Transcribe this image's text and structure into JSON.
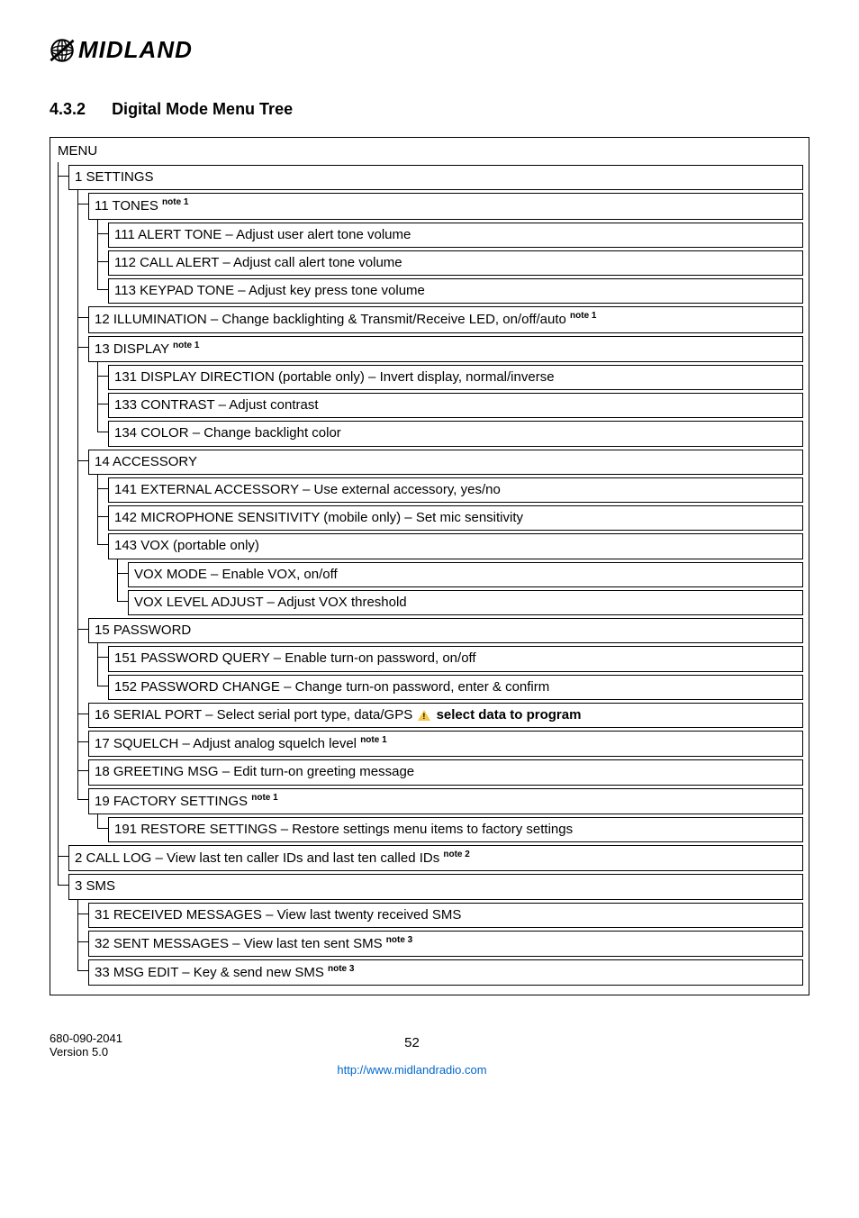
{
  "logo": {
    "brand": "MIDLAND"
  },
  "section": {
    "number": "4.3.2",
    "title": "Digital Mode Menu Tree"
  },
  "menu": {
    "root": "MENU",
    "n1": "1 SETTINGS",
    "n11": "11 TONES ",
    "n11_note": "note 1",
    "n111": "111 ALERT TONE – Adjust user alert tone volume",
    "n112": "112 CALL ALERT – Adjust call alert tone volume",
    "n113": "113 KEYPAD TONE – Adjust key press tone volume",
    "n12": "12 ILLUMINATION – Change backlighting & Transmit/Receive LED, on/off/auto ",
    "n12_note": "note 1",
    "n13": "13 DISPLAY ",
    "n13_note": "note 1",
    "n131": "131 DISPLAY DIRECTION (portable only) – Invert display, normal/inverse",
    "n133": "133 CONTRAST – Adjust contrast",
    "n134": "134 COLOR – Change backlight color",
    "n14": "14 ACCESSORY",
    "n141": "141 EXTERNAL ACCESSORY – Use external accessory, yes/no",
    "n142": "142 MICROPHONE SENSITIVITY (mobile only) – Set mic sensitivity",
    "n143": "143 VOX (portable only)",
    "n143a": "VOX MODE – Enable VOX, on/off",
    "n143b": "VOX LEVEL ADJUST – Adjust VOX threshold",
    "n15": "15 PASSWORD",
    "n151": "151 PASSWORD QUERY – Enable turn-on password, on/off",
    "n152": "152 PASSWORD CHANGE – Change turn-on password, enter & confirm",
    "n16a": "16 SERIAL PORT – Select serial port type, data/GPS ",
    "n16b": " select data to program",
    "n17": "17 SQUELCH – Adjust analog squelch level ",
    "n17_note": "note 1",
    "n18": "18 GREETING MSG – Edit turn-on greeting message",
    "n19": "19 FACTORY SETTINGS ",
    "n19_note": "note 1",
    "n191": "191 RESTORE SETTINGS – Restore settings menu items to factory settings",
    "n2": "2 CALL LOG – View last ten caller IDs and last ten called IDs ",
    "n2_note": "note 2",
    "n3": "3 SMS",
    "n31": "31 RECEIVED MESSAGES – View last twenty received SMS",
    "n32": "32 SENT MESSAGES – View last ten sent SMS ",
    "n32_note": "note 3",
    "n33": "33 MSG EDIT – Key & send new SMS ",
    "n33_note": "note 3"
  },
  "footer": {
    "doc": "680-090-2041",
    "version": "Version 5.0",
    "page": "52",
    "url": "http://www.midlandradio.com"
  }
}
